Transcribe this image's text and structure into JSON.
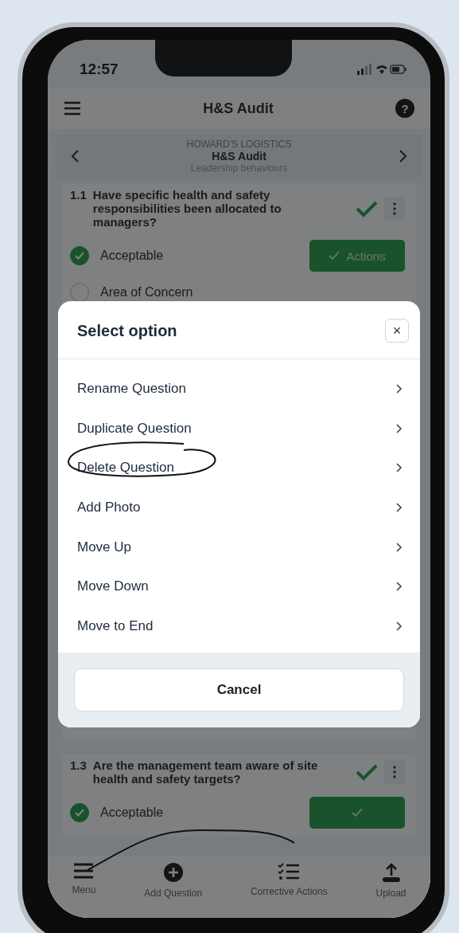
{
  "status_bar": {
    "time": "12:57"
  },
  "header": {
    "title": "H&S Audit",
    "help": "?"
  },
  "section_nav": {
    "company": "HOWARD'S LOGISTICS",
    "audit": "H&S Audit",
    "section": "Leadership behaviours"
  },
  "questions": [
    {
      "number": "1.1",
      "text": "Have specific health and safety responsibilities been allocated to managers?",
      "answered": true,
      "options": [
        {
          "label": "Acceptable",
          "selected": true
        },
        {
          "label": "Area of Concern",
          "selected": false
        }
      ],
      "actions_label": "Actions"
    },
    {
      "number": "1.3",
      "text": "Are the management team aware of site health and safety targets?",
      "answered": true,
      "options": [
        {
          "label": "Acceptable",
          "selected": true
        }
      ]
    }
  ],
  "dialog": {
    "title": "Select option",
    "close": "×",
    "options": [
      "Rename Question",
      "Duplicate Question",
      "Delete Question",
      "Add Photo",
      "Move Up",
      "Move Down",
      "Move to End"
    ],
    "cancel": "Cancel"
  },
  "tab_bar": [
    {
      "label": "Menu",
      "kind": "menu"
    },
    {
      "label": "Add Question",
      "kind": "add"
    },
    {
      "label": "Corrective Actions",
      "kind": "checklist"
    },
    {
      "label": "Upload",
      "kind": "upload"
    }
  ]
}
